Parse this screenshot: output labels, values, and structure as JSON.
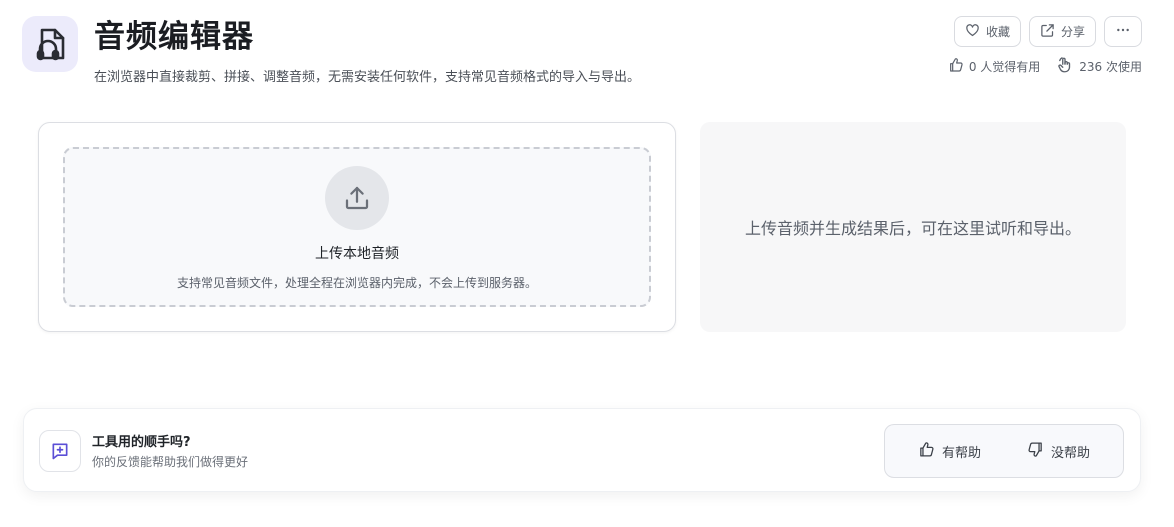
{
  "header": {
    "title": "音频编辑器",
    "subtitle": "在浏览器中直接裁剪、拼接、调整音频，无需安装任何软件，支持常见音频格式的导入与导出。",
    "icon": "audio-file-icon",
    "accent": "#5b4fd6"
  },
  "actions": {
    "favorite_label": "收藏",
    "share_label": "分享",
    "more_icon": "more-horizontal-icon"
  },
  "stats": {
    "likes": "0 人觉得有用",
    "uses": "236 次使用"
  },
  "upload": {
    "label": "上传本地音频",
    "hint": "支持常见音频文件，处理全程在浏览器内完成，不会上传到服务器。",
    "icon": "upload-icon"
  },
  "result": {
    "placeholder": "上传音频并生成结果后，可在这里试听和导出。"
  },
  "feedback": {
    "title": "工具用的顺手吗?",
    "subtitle": "你的反馈能帮助我们做得更好",
    "helpful_label": "有帮助",
    "not_helpful_label": "没帮助",
    "icon": "message-plus-icon"
  }
}
